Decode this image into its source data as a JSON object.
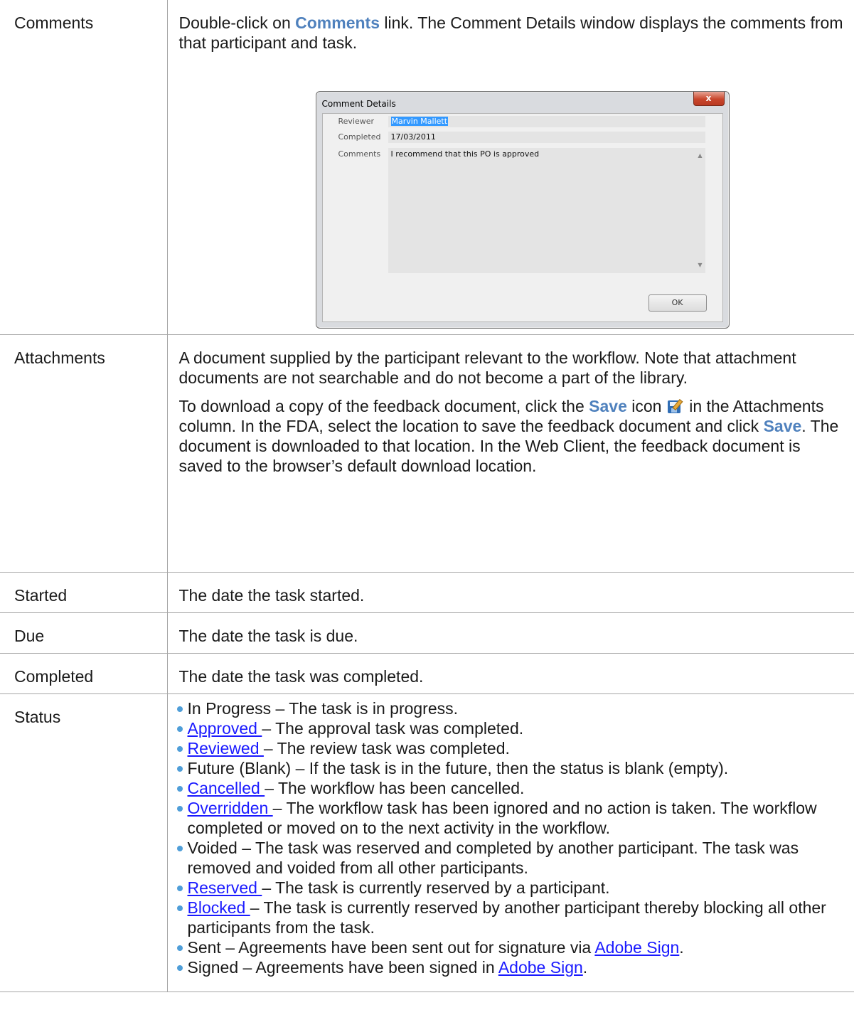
{
  "rows": {
    "comments": {
      "term": "Comments",
      "text_before": "Double-click on ",
      "link_label": "Comments",
      "text_after": " link. The Comment Details window displays the comments from that participant and task.",
      "dialog": {
        "title": "Comment Details",
        "close_label": "x",
        "reviewer_label": "Reviewer",
        "reviewer_value": "Marvin Mallett",
        "completed_label": "Completed",
        "completed_value": "17/03/2011",
        "comments_label": "Comments",
        "comments_value": "I recommend that this PO is approved",
        "ok_label": "OK"
      }
    },
    "attachments": {
      "term": "Attachments",
      "para1": "A document supplied by the participant relevant to the workflow. Note that attachment documents are not searchable and do not become a part of the library.",
      "para2_a": "To download a copy of the feedback document, click the ",
      "para2_save1": "Save",
      "para2_b": " icon ",
      "para2_c": " in the Attachments column. In the FDA, select the location to save the feedback document and click ",
      "para2_save2": "Save",
      "para2_d": ". The document is downloaded to that location. In the Web Client, the feedback document is saved to the browser’s default download location."
    },
    "started": {
      "term": "Started",
      "text": "The date the task started."
    },
    "due": {
      "term": "Due",
      "text": "The date the task is due."
    },
    "completed": {
      "term": "Completed",
      "text": "The date the task was completed."
    },
    "status": {
      "term": "Status",
      "items": [
        {
          "plain": "In Progress",
          "rest": " – The task is in progress."
        },
        {
          "link": "Approved ",
          "rest": "– The approval task was completed."
        },
        {
          "link": "Reviewed ",
          "rest": "– The review task was completed."
        },
        {
          "plain": "Future (Blank)",
          "rest": " – If the task is in the future, then the status is blank (empty)."
        },
        {
          "link": "Cancelled ",
          "rest": "– The workflow has been cancelled."
        },
        {
          "link": "Overridden ",
          "rest": "– The workflow task has been ignored and no action is taken. The workflow completed or moved on to the next activity in the workflow."
        },
        {
          "plain": "Voided",
          "rest": " – The task was reserved and completed by another participant. The task was removed and voided from all other participants."
        },
        {
          "link": "Reserved ",
          "rest": "– The task is currently reserved by a participant."
        },
        {
          "link": "Blocked ",
          "rest": "– The task is currently reserved by another participant thereby blocking all other participants from the task."
        },
        {
          "plain": "Sent",
          "rest": " – Agreements have been sent out for signature via ",
          "tail_link": "Adobe Sign",
          "tail": "."
        },
        {
          "plain": "Signed",
          "rest": " – Agreements have been signed in ",
          "tail_link": "Adobe Sign",
          "tail": "."
        }
      ]
    }
  },
  "colors": {
    "accent_bold": "#4f81bd",
    "link": "#1a1aff",
    "bullet": "#4f9ed8",
    "border": "#a6a6a6"
  },
  "icons": {
    "save": "save-edit-icon",
    "close": "close-icon"
  }
}
